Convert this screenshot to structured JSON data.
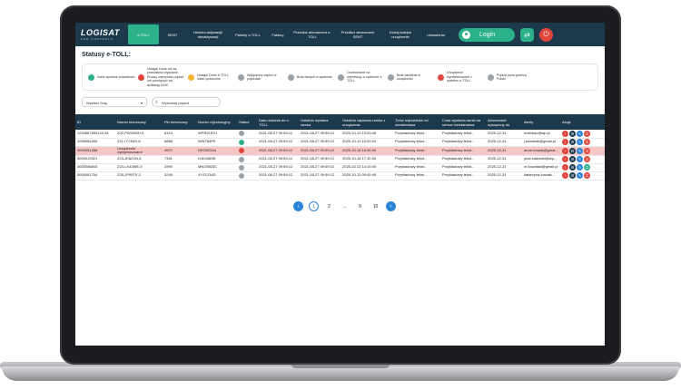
{
  "header": {
    "logo": "LOGISAT",
    "logo_sub": "FOR CONTROLS",
    "nav": [
      "e-TOLL",
      "SENT",
      "Historia aktywacji/ dezaktywacji",
      "Pakiety e-TOLL",
      "Faktury",
      "Przedłuż abonament e-TOLL",
      "Przedłuż abonament SENT",
      "Dodaj kolejne urządzenie",
      "Ustawienia"
    ],
    "login_label": "Login",
    "swap_icon": "⇄",
    "power_icon": "⏻"
  },
  "page_title": "Statusy e-TOLL:",
  "statuses": [
    {
      "text": "Dane wysłane prawidłowo",
      "color": "#2db18a"
    },
    {
      "text": "Uwaga! Dane nie są prawidłowo wysyłane. Proszę zatrzymać pojazd lub przełączyć na aplikację KAS!",
      "color": "#e0443b"
    },
    {
      "text": "Uwaga! Dane e-TOLL lekko opóźnione",
      "color": "#f2b233"
    },
    {
      "text": "Wyłączony zapłon w pojeździe",
      "color": "#9aa1a7"
    },
    {
      "text": "Brak danych w systemie",
      "color": "#9aa1a7"
    },
    {
      "text": "Oczekiwanie na rejestrację w systemie e-TOLL",
      "color": "#9aa1a7"
    },
    {
      "text": "Brak zasilania w urządzeniu",
      "color": "#9aa1a7"
    },
    {
      "text": "Urządzenie wyrejestrowane z systemu e-TOLL",
      "color": "#e0443b"
    },
    {
      "text": "Pojazd poza granicą Polski",
      "color": "#9aa1a7"
    }
  ],
  "filter": {
    "placeholder": "Wybierz flotę"
  },
  "search": {
    "placeholder": "Wyszukaj pojazd"
  },
  "table": {
    "headers": [
      "ID",
      "Numer biznesowy",
      "Pin biznesowy",
      "Numer rejestracyjny",
      "Status",
      "Data dodania do e-TOLL",
      "Ostatnio wysłana ramka",
      "Ostatnio zapisana ramka z urządzenia",
      "Treść odpowiedzi od ministerstwa",
      "Czas wysłania ramki na serwer ministerstwa",
      "Abonament wykupiony do",
      "Alerty",
      "Akcje"
    ],
    "rows": [
      {
        "id": "1234567890123 45",
        "biz": "Z22-PW25WH-5",
        "pin": "6314",
        "reg": "WPR5157U",
        "status": "#9aa1a7",
        "added": "2021-08-27 09:59:12",
        "sent": "2021-08-27 09:59:12",
        "saved": "2025-10-13 13:20:45",
        "resp": "Przykładowy tekst...",
        "ministry": "Przykładowy tekst...",
        "sub": "2025-12-31",
        "alert": "mathbac@wp.pl",
        "hl": false
      },
      {
        "id": "1006084265",
        "biz": "Z21-IY74NS-8",
        "pin": "8888",
        "reg": "WW784PE",
        "status": "#2db18a",
        "added": "2021-08-27 09:59:12",
        "sent": "2021-08-27 09:59:12",
        "saved": "2025-10-13 15:00:10",
        "resp": "Przykładowy tekst...",
        "ministry": "Przykładowy tekst...",
        "sub": "2025-12-31",
        "alert": "j.kowalski@gmail.pl",
        "hl": false
      },
      {
        "id": "3000051368",
        "biz": "Urządzenie wyrejestrowane",
        "pin": "4572",
        "reg": "DFG8231A",
        "status": "#e0443b",
        "added": "2021-08-27 09:59:12",
        "sent": "2021-08-27 09:59:12",
        "saved": "2025-10-18 15:45:00",
        "resp": "Przykładowy tekst...",
        "ministry": "Przykładowy tekst...",
        "sub": "2025-12-31",
        "alert": "anna.nowak@gmai...",
        "hl": true
      },
      {
        "id": "3000019321",
        "biz": "Z23-JK82VN-5",
        "pin": "7391",
        "reg": "HJK4569B",
        "status": "#9aa1a7",
        "added": "2021-08-27 09:59:12",
        "sent": "2021-08-27 09:59:12",
        "saved": "2025-10-18 17:30:00",
        "resp": "Przykładowy tekst...",
        "ministry": "Przykładowy tekst...",
        "sub": "2025-12-31",
        "alert": "piotr.zalewski@wp...",
        "hl": false
      },
      {
        "id": "4000056843",
        "biz": "Z24-LK43WE-5",
        "pin": "2890",
        "reg": "MNO9823C",
        "status": "#9aa1a7",
        "added": "2021-08-27 09:59:12",
        "sent": "2021-08-27 09:59:12",
        "saved": "2025-10-13 14:15:00",
        "resp": "Przykładowy tekst...",
        "ministry": "Przykładowy tekst...",
        "sub": "2025-12-31",
        "alert": "m.kowalski@gmail.pl",
        "hl": false
      },
      {
        "id": "5000061754",
        "biz": "Z25-JP95TX-2",
        "pin": "3245",
        "reg": "XYZ1234D",
        "status": "#9aa1a7",
        "added": "2021-08-27 09:59:12",
        "sent": "2021-08-27 09:59:12",
        "saved": "2025-10-13 09:45:45",
        "resp": "Przykładowy tekst...",
        "ministry": "Przykładowy tekst...",
        "sub": "2025-12-31",
        "alert": "katarzyna.kowals...",
        "hl": false
      }
    ]
  },
  "pagination": {
    "pages": [
      "1",
      "2",
      "...",
      "9",
      "10"
    ],
    "current": "1"
  }
}
